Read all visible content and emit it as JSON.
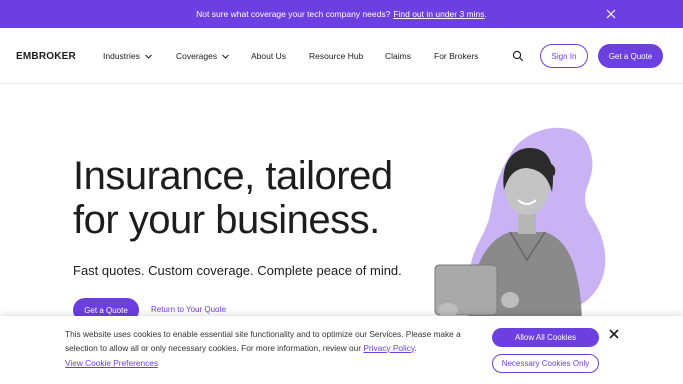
{
  "announcement": {
    "text": "Not sure what coverage your tech company needs?",
    "link": "Find out in under 3 mins",
    "suffix": "."
  },
  "nav": {
    "logo": "EMBROKER",
    "items": [
      {
        "label": "Industries",
        "has_dropdown": true
      },
      {
        "label": "Coverages",
        "has_dropdown": true
      },
      {
        "label": "About Us",
        "has_dropdown": false
      },
      {
        "label": "Resource Hub",
        "has_dropdown": false
      },
      {
        "label": "Claims",
        "has_dropdown": false
      },
      {
        "label": "For Brokers",
        "has_dropdown": false
      }
    ],
    "sign_in": "Sign In",
    "get_quote": "Get a Quote"
  },
  "hero": {
    "title_line1": "Insurance, tailored",
    "title_line2": "for your business.",
    "subtitle": "Fast quotes. Custom coverage. Complete peace of mind.",
    "cta": "Get a Quote",
    "secondary_link": "Return to Your Quote"
  },
  "cookie": {
    "text": "This website uses cookies to enable essential site functionality and to optimize our Services. Please make a selection to allow all or only necessary cookies. For more information, review our",
    "policy_link": "Privacy Policy",
    "policy_suffix": ".",
    "preferences_link": "View Cookie Preferences",
    "allow_all": "Allow All Cookies",
    "necessary_only": "Necessary Cookies Only"
  },
  "colors": {
    "brand": "#6c3fe0",
    "art_blob": "#c9b3f5",
    "text": "#1d1d1f"
  }
}
